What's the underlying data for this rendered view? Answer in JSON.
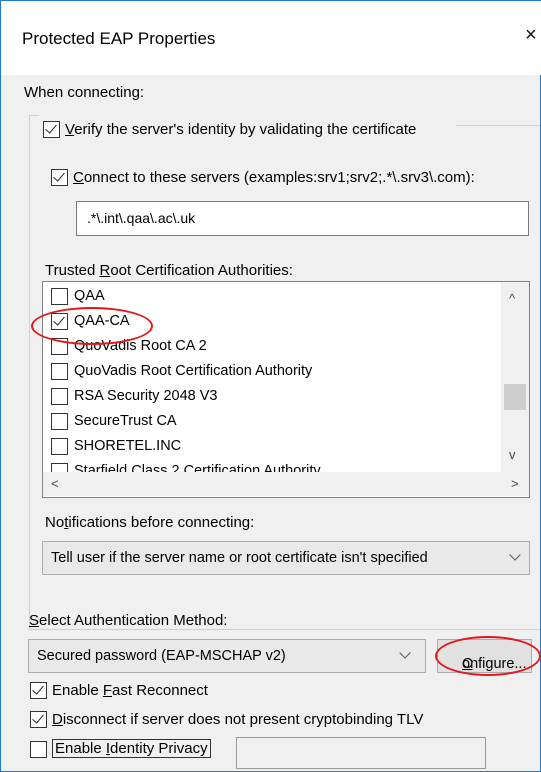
{
  "window": {
    "title": "Protected EAP Properties",
    "close_glyph": "×"
  },
  "when_connecting": "When connecting:",
  "verify_cert": {
    "mnemonic": "V",
    "rest": "erify the server's identity by validating the certificate",
    "checked": true
  },
  "connect_servers": {
    "mnemonic": "C",
    "rest": "onnect to these servers (examples:srv1;srv2;.*\\.srv3\\.com):",
    "checked": true
  },
  "servers_value": ".*\\.int\\.qaa\\.ac\\.uk",
  "trusted_root": {
    "before": "Trusted ",
    "mnemonic": "R",
    "after": "oot Certification Authorities:"
  },
  "ca_list": [
    {
      "label": "QAA",
      "checked": false
    },
    {
      "label": "QAA-CA",
      "checked": true
    },
    {
      "label": "QuoVadis Root CA 2",
      "checked": false
    },
    {
      "label": "QuoVadis Root Certification Authority",
      "checked": false
    },
    {
      "label": "RSA Security 2048 V3",
      "checked": false
    },
    {
      "label": "SecureTrust CA",
      "checked": false
    },
    {
      "label": "SHORETEL.INC",
      "checked": false
    },
    {
      "label": "Starfield Class 2 Certification Authority",
      "checked": false
    }
  ],
  "scroll_glyphs": {
    "up": "^",
    "down": "v",
    "left": "<",
    "right": ">"
  },
  "notifications": {
    "before": "No",
    "mnemonic": "t",
    "after": "ifications before connecting:",
    "value": "Tell user if the server name or root certificate isn't specified"
  },
  "auth_method": {
    "mnemonic": "S",
    "rest": "elect Authentication Method:",
    "value": "Secured password (EAP-MSCHAP v2)"
  },
  "configure_button": {
    "mnemonic": "C",
    "rest": "onfigure..."
  },
  "fast_reconnect": {
    "before": "Enable ",
    "mnemonic": "F",
    "after": "ast Reconnect",
    "checked": true
  },
  "disconnect_tlv": {
    "mnemonic": "D",
    "rest": "isconnect if server does not present cryptobinding TLV",
    "checked": true
  },
  "identity_privacy": {
    "before": "Enable ",
    "mnemonic": "I",
    "after": "dentity Privacy",
    "checked": false,
    "value": ""
  },
  "annotation_color": "#e3161b"
}
